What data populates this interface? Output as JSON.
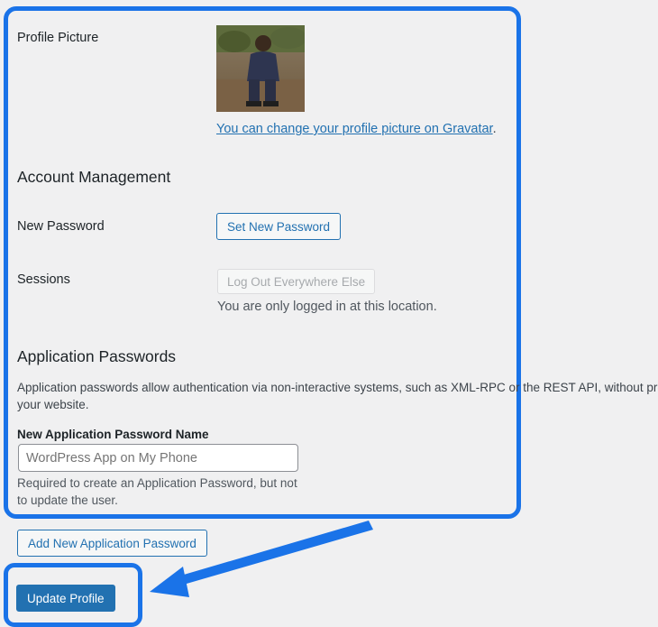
{
  "profile_picture": {
    "label": "Profile Picture",
    "gravatar_link": "You can change your profile picture on Gravatar",
    "gravatar_period": "."
  },
  "account_management": {
    "title": "Account Management",
    "new_password_label": "New Password",
    "set_password_button": "Set New Password",
    "sessions_label": "Sessions",
    "logout_button": "Log Out Everywhere Else",
    "sessions_note": "You are only logged in at this location."
  },
  "application_passwords": {
    "title": "Application Passwords",
    "description_line1": "Application passwords allow authentication via non-interactive systems, such as XML-RPC or the REST API, without providing",
    "description_line2": "your website.",
    "name_label": "New Application Password Name",
    "name_placeholder": "WordPress App on My Phone",
    "help_line1": "Required to create an Application Password, but not",
    "help_line2": "to update the user.",
    "add_button": "Add New Application Password"
  },
  "footer": {
    "update_button": "Update Profile"
  },
  "colors": {
    "highlight": "#1a73e8",
    "wp_blue": "#2271b1",
    "background": "#f0f0f1"
  }
}
